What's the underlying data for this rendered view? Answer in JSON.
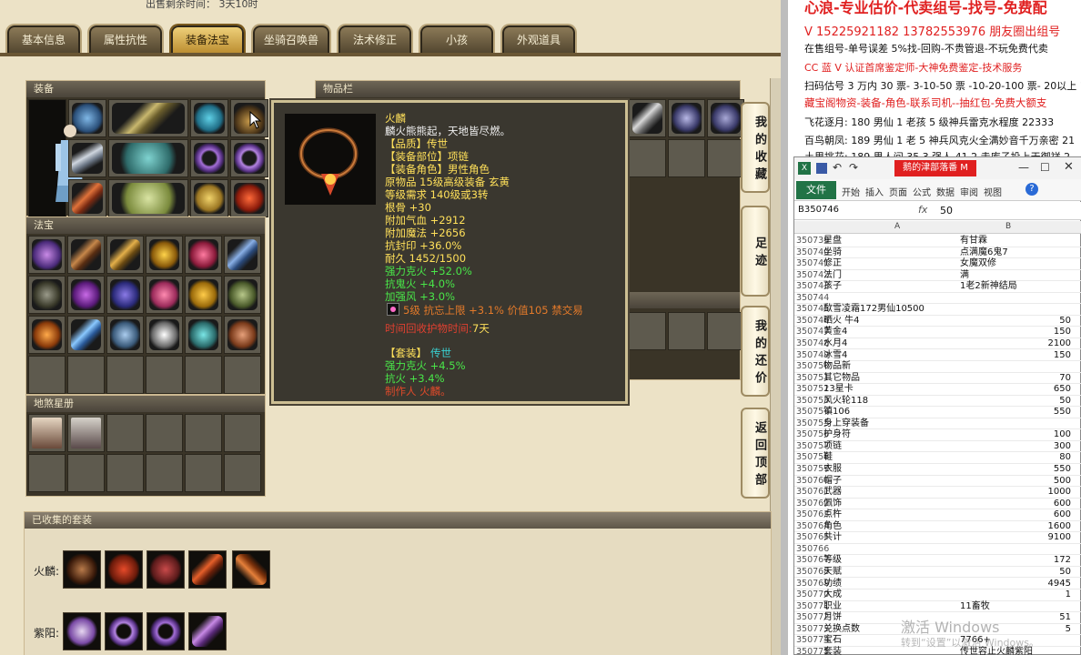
{
  "game": {
    "top_line": "出售剩余时间： 3天10时",
    "tabs": [
      "基本信息",
      "属性抗性",
      "装备法宝",
      "坐骑召唤兽",
      "法术修正",
      "小孩",
      "外观道具"
    ],
    "active_tab": "装备法宝",
    "panels": {
      "equip": "装备",
      "fabao": "法宝",
      "tianjie": "地煞星册",
      "items": "物品栏",
      "sets": "已收集的套装"
    },
    "side_buttons": [
      "我的收藏",
      "足迹",
      "我的还价",
      "返回顶部"
    ],
    "set_rows": [
      {
        "label": "火麟:"
      },
      {
        "label": "紫阳:"
      }
    ],
    "tooltip": {
      "name": "火麟",
      "desc": "麟火熊熊起，天地皆尽燃。",
      "quality": "【品质】传世",
      "slot": "【装备部位】项链",
      "role": "【装备角色】男性角色",
      "origin": "原物品 15级高级装备 玄黄",
      "req": "等级需求 140级或3转",
      "gengu": "根骨 +30",
      "qixue": "附加气血 +2912",
      "mofa": "附加魔法 +2656",
      "kangfeng": "抗封印 +36.0%",
      "naijiu": "耐久 1452/1500",
      "kehuo": "强力克火 +52.0%",
      "kanghuo": "抗鬼火 +4.0%",
      "jiaqiang": "加强风 +3.0%",
      "gem": "5级 抗忘上限 +3.1% 价值105 禁交易",
      "time": "时间回收护物时间:",
      "time_val": "7天",
      "set_label": "【套装】",
      "set_name": "传世",
      "set_a": "强力克火 +4.5%",
      "set_b": "抗火 +3.4%",
      "maker": "制作人 火麟。"
    }
  },
  "ads": {
    "line0": "心浪-专业估价-代卖组号-找号-免费配",
    "line1": "V 15225921182   13782553976 朋友圈出组号",
    "line2": "在售组号-单号误差 5%找-回购-不贵管退-不玩免费代卖",
    "line3": "CC 蓝 V 认证首席鉴定师-大神免费鉴定-技术服务",
    "line4": "扫码估号 3 万内 30 票- 3-10-50 票  -10-20-100 票- 20以上 150",
    "line5": "藏宝阁物资-装备-角色-联系司机--抽红包-免费大额支",
    "line6": "飞花逐月: 180 男仙 1 老孩 5 级神兵雷克水程度 22333",
    "line7": "百鸟朝凤: 189 男仙 1 老 5 神兵风克火全满妙音千万亲密 21",
    "line8": "土里挑花: 189 男人间 35 3 强人 41 2 走库子投上天御祥 2"
  },
  "excel": {
    "title_tab": "鹅的津部落番 M",
    "file": "文件",
    "ribbon_tabs": [
      "开始",
      "插入",
      "页面",
      "公式",
      "数据",
      "审阅",
      "视图"
    ],
    "cell_ref": "B350746",
    "formula": "50",
    "col_a": "A",
    "col_b": "B",
    "rows": [
      {
        "n": "350739",
        "a": "星盘",
        "b": "有甘霖"
      },
      {
        "n": "350740",
        "a": "坐骑",
        "b": "点满魔6鬼7"
      },
      {
        "n": "350741",
        "a": "修正",
        "b": "女魔双修"
      },
      {
        "n": "350742",
        "a": "法门",
        "b": "满"
      },
      {
        "n": "350743",
        "a": "孩子",
        "b": "1老2新神结局"
      },
      {
        "n": "350744",
        "a": "",
        "b": ""
      },
      {
        "n": "350745",
        "a": "歃雪凌霜172男仙10500",
        "b": ""
      },
      {
        "n": "350746",
        "a": "晒火 牛4",
        "b": "50",
        "num": true
      },
      {
        "n": "350747",
        "a": "黄金4",
        "b": "150",
        "num": true
      },
      {
        "n": "350748",
        "a": "水月4",
        "b": "2100",
        "num": true
      },
      {
        "n": "350749",
        "a": "冰雪4",
        "b": "150",
        "num": true
      },
      {
        "n": "350750",
        "a": "物品新",
        "b": ""
      },
      {
        "n": "350751",
        "a": "其它物品",
        "b": "70",
        "num": true
      },
      {
        "n": "350752",
        "a": "13星卡",
        "b": "650",
        "num": true
      },
      {
        "n": "350753",
        "a": "风火轮118",
        "b": "50",
        "num": true
      },
      {
        "n": "350754",
        "a": "镇106",
        "b": "550",
        "num": true
      },
      {
        "n": "350755",
        "a": "身上穿装备",
        "b": ""
      },
      {
        "n": "350756",
        "a": "护身符",
        "b": "100",
        "num": true
      },
      {
        "n": "350757",
        "a": "项链",
        "b": "300",
        "num": true
      },
      {
        "n": "350758",
        "a": "鞋",
        "b": "80",
        "num": true
      },
      {
        "n": "350759",
        "a": "衣服",
        "b": "550",
        "num": true
      },
      {
        "n": "350760",
        "a": "帽子",
        "b": "500",
        "num": true
      },
      {
        "n": "350761",
        "a": "武器",
        "b": "1000",
        "num": true
      },
      {
        "n": "350762",
        "a": "佩饰",
        "b": "600",
        "num": true
      },
      {
        "n": "350763",
        "a": "点杵",
        "b": "600",
        "num": true
      },
      {
        "n": "350764",
        "a": "角色",
        "b": "1600",
        "num": true
      },
      {
        "n": "350765",
        "a": "共计",
        "b": "9100",
        "num": true
      },
      {
        "n": "350766",
        "a": "",
        "b": ""
      },
      {
        "n": "350767",
        "a": "等级",
        "b": "172",
        "num": true
      },
      {
        "n": "350768",
        "a": "天赋",
        "b": "50",
        "num": true
      },
      {
        "n": "350769",
        "a": "功绩",
        "b": "4945",
        "num": true
      },
      {
        "n": "350770",
        "a": "大成",
        "b": "1",
        "num": true
      },
      {
        "n": "350771",
        "a": "职业",
        "b": "11畜牧"
      },
      {
        "n": "350772",
        "a": "月饼",
        "b": "51",
        "num": true
      },
      {
        "n": "350773",
        "a": "兑换点数",
        "b": "5",
        "num": true
      },
      {
        "n": "350774",
        "a": "宝石",
        "b": "7766+"
      },
      {
        "n": "350775",
        "a": "套装",
        "b": "传世容止火麟紫阳"
      }
    ]
  },
  "watermark": {
    "line1": "激活 Windows",
    "line2": "转到“设置”以激活 Windows。"
  }
}
